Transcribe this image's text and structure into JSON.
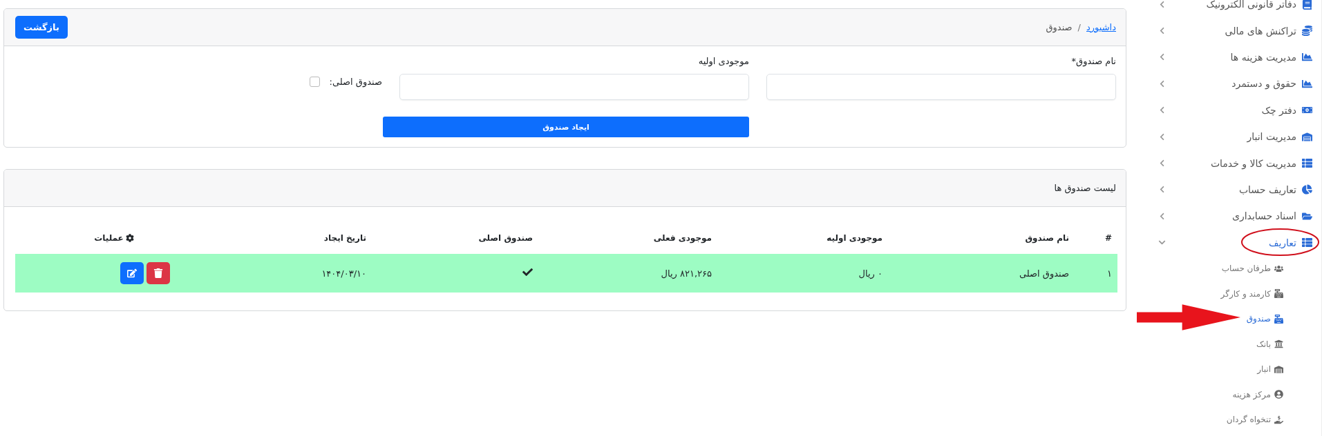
{
  "breadcrumb": [
    {
      "label": "داشبورد",
      "link": true
    },
    {
      "label": "صندوق",
      "link": false
    }
  ],
  "breadcrumb_separator": "/",
  "back_button": "بازگشت",
  "form": {
    "name_label": "نام صندوق*",
    "balance_label": "موجودی اولیه",
    "main_checkbox": {
      "label": "صندوق اصلی:",
      "checked": false
    },
    "submit": "ایجاد صندوق"
  },
  "list": {
    "title": "لیست صندوق ها",
    "columns": [
      "#",
      "نام صندوق",
      "موجودی اولیه",
      "موجودی فعلی",
      "صندوق اصلی",
      "تاریخ ایجاد",
      "عملیات"
    ],
    "rows": [
      {
        "index": "۱",
        "name": "صندوق اصلی",
        "initial": "۰ ریال",
        "current": "۸۲۱,۲۶۵ ریال",
        "is_main": true,
        "date": "۱۴۰۴/۰۳/۱۰",
        "highlighted": true
      }
    ]
  },
  "sidebar": {
    "items": [
      {
        "label": "دفاتر قانونی الکترونیک",
        "expanded": false,
        "selected": false
      },
      {
        "label": "تراکنش های مالی",
        "expanded": false,
        "selected": false
      },
      {
        "label": "مدیریت هزینه ها",
        "expanded": false,
        "selected": false
      },
      {
        "label": "حقوق و دستمرد",
        "expanded": false,
        "selected": false
      },
      {
        "label": "دفتر چک",
        "expanded": false,
        "selected": false
      },
      {
        "label": "مدیریت انبار",
        "expanded": false,
        "selected": false
      },
      {
        "label": "مدیریت کالا و خدمات",
        "expanded": false,
        "selected": false
      },
      {
        "label": "تعاریف حساب",
        "expanded": false,
        "selected": false
      },
      {
        "label": "اسناد حسابداری",
        "expanded": false,
        "selected": false
      },
      {
        "label": "تعاریف",
        "expanded": true,
        "selected": true,
        "children": [
          {
            "label": "طرفان حساب",
            "selected": false
          },
          {
            "label": "کارمند و کارگر",
            "selected": false
          },
          {
            "label": "صندوق",
            "selected": true
          },
          {
            "label": "بانک",
            "selected": false
          },
          {
            "label": "انبار",
            "selected": false
          },
          {
            "label": "مرکز هزینه",
            "selected": false
          },
          {
            "label": "تنخواه گردان",
            "selected": false
          }
        ]
      }
    ]
  }
}
